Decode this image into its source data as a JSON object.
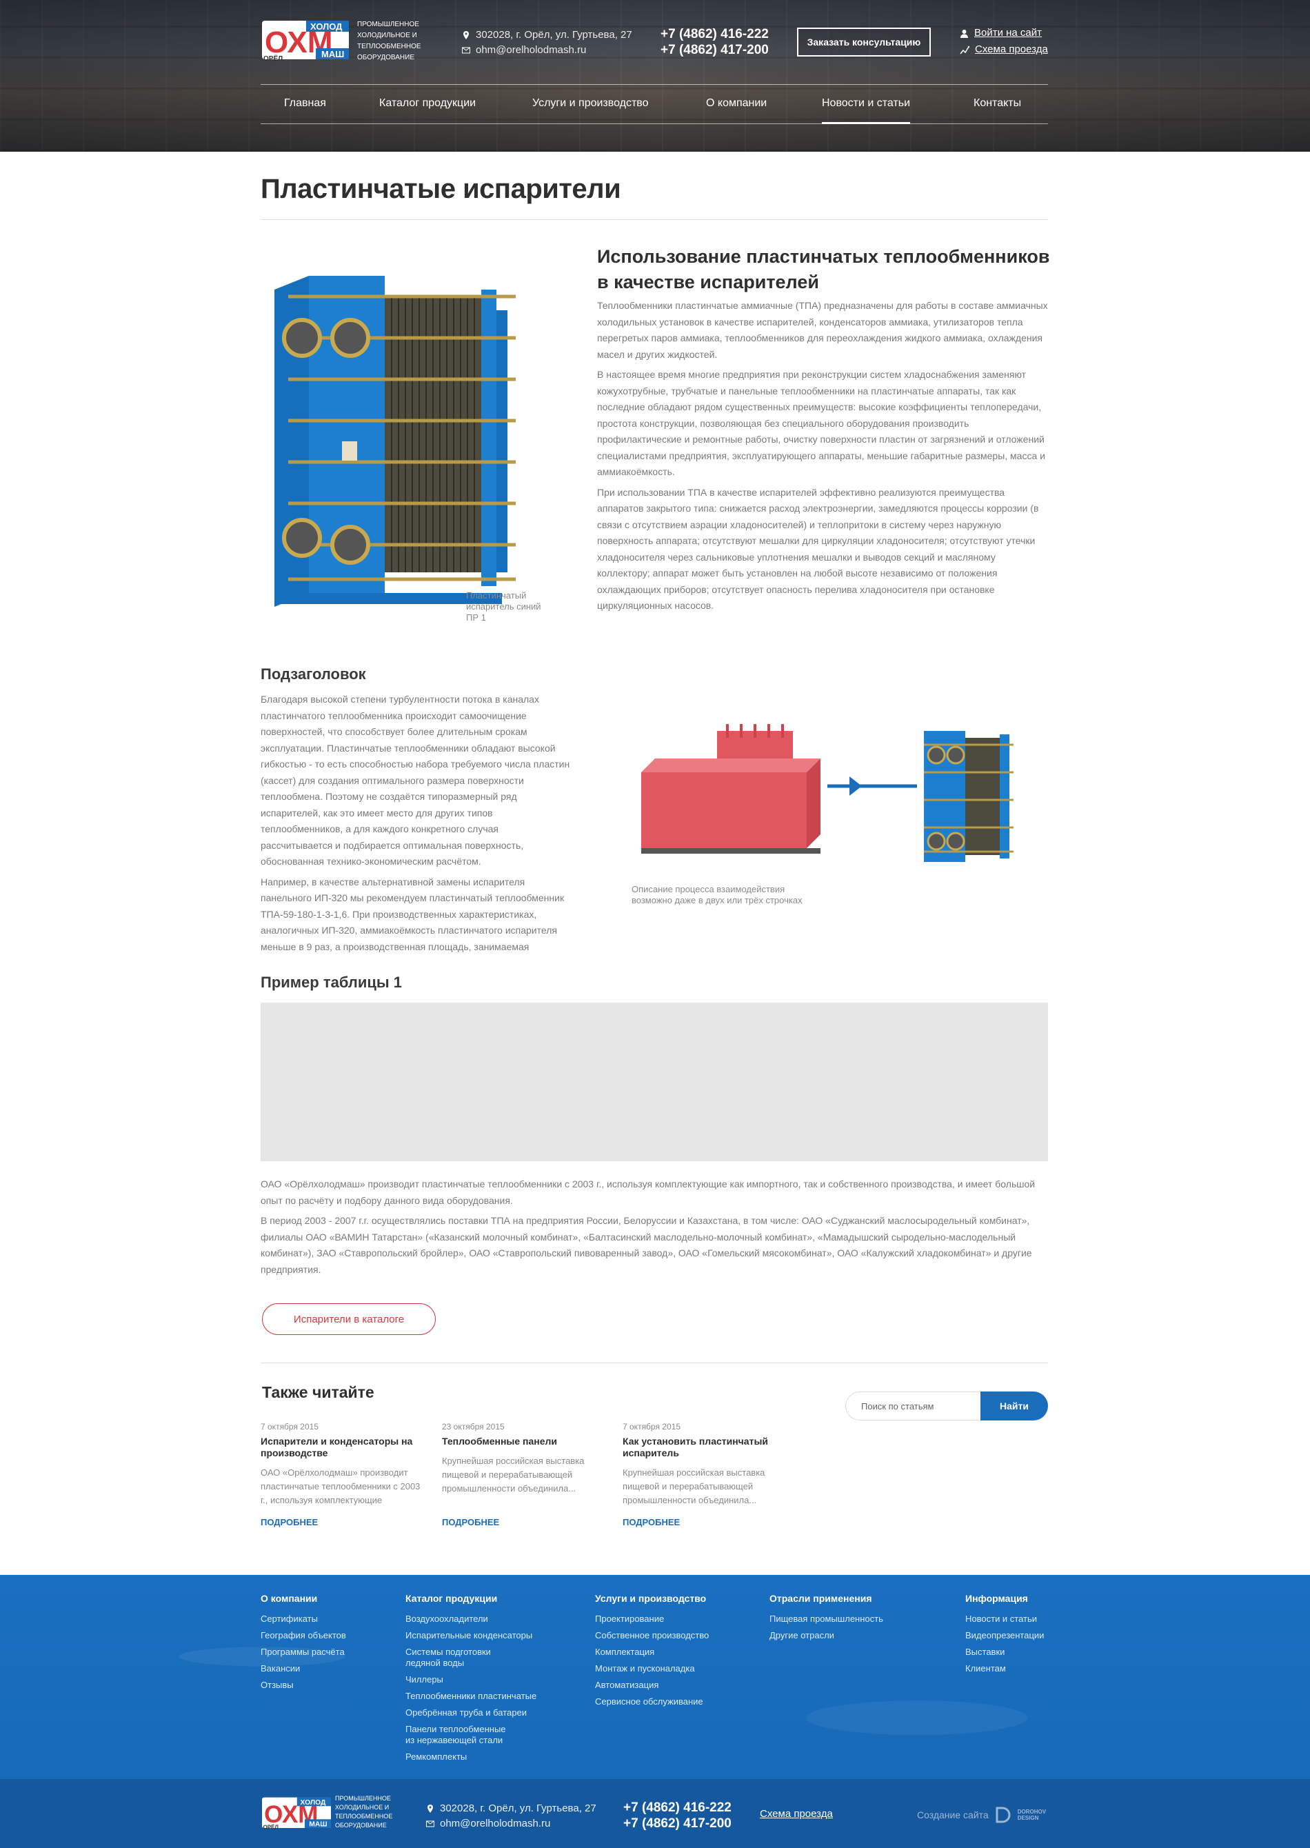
{
  "header": {
    "logo_text": "Промышленное холодильное и теплообменное оборудование",
    "logo_letters": "ОХМ",
    "logo_top": "ХОЛОД",
    "logo_bottom": "МАШ",
    "logo_city": "ОРЁЛ",
    "address": "302028, г. Орёл, ул. Гуртьева, 27",
    "email": "ohm@orelholodmash.ru",
    "phone1": "+7 (4862) 416-222",
    "phone2": "+7 (4862) 417-200",
    "consult_button": "Заказать консультацию",
    "login_link": "Войти на сайт",
    "route_link": "Схема проезда"
  },
  "nav": {
    "items": [
      {
        "label": "Главная"
      },
      {
        "label": "Каталог продукции"
      },
      {
        "label": "Услуги и производство"
      },
      {
        "label": "О компании"
      },
      {
        "label": "Новости и статьи"
      },
      {
        "label": "Контакты"
      }
    ],
    "active": "Новости и статьи"
  },
  "page": {
    "title": "Пластинчатые испарители"
  },
  "section1": {
    "image_caption": "Пластинчатый испаритель синий ПР 1",
    "title": "Использование пластинчатых теплообменников в качестве испарителей",
    "paragraphs": [
      "Теплообменники пластинчатые аммиачные (ТПА) предназначены для работы в составе аммиачных холодильных установок в качестве испарителей, конденсаторов аммиака, утилизаторов тепла перегретых паров аммиака, теплообменников для переохлаждения жидкого аммиака, охлаждения масел и других жидкостей.",
      "В настоящее время многие предприятия при реконструкции систем хладоснабжения заменяют кожухотрубные, трубчатые и панельные теплообменники на пластинчатые аппараты, так как последние обладают рядом существенных преимуществ: высокие коэффициенты теплопередачи, простота конструкции, позволяющая без специального оборудования производить профилактические и ремонтные работы, очистку поверхности пластин от загрязнений и отложений специалистами предприятия, эксплуатирующего аппараты, меньшие габаритные размеры, масса и аммиакоёмкость.",
      "При использовании ТПА в качестве испарителей эффективно реализуются преимущества аппаратов закрытого типа: снижается расход электроэнергии, замедляются процессы коррозии (в связи с отсутствием аэрации хладоносителей) и теплопритоки в систему через наружную поверхность аппарата; отсутствуют мешалки для циркуляции хладоносителя; отсутствуют утечки хладоносителя через сальниковые уплотнения мешалки и выводов секций и масляному коллектору; аппарат может быть установлен на любой высоте независимо от положения охлаждающих приборов; отсутствует опасность перелива хладоносителя при остановке циркуляционных насосов."
    ]
  },
  "section2": {
    "title": "Подзаголовок",
    "paragraphs": [
      "Благодаря высокой степени турбулентности потока в каналах пластинчатого теплообменника происходит самоочищение поверхностей, что способствует более длительным срокам эксплуатации. Пластинчатые теплообменники обладают высокой гибкостью - то есть способностью набора требуемого числа пластин (кассет) для создания оптимального размера поверхности теплообмена. Поэтому не создаётся типоразмерный ряд испарителей, как это имеет место для других типов теплообменников, а для каждого конкретного случая рассчитывается и подбирается оптимальная поверхность, обоснованная технико-экономическим расчётом.",
      "Например, в качестве альтернативной замены испарителя панельного ИП-320 мы рекомендуем пластинчатый теплообменник ТПА-59-180-1-3-1,6. При производственных характеристиках, аналогичных ИП-320, аммиакоёмкость пластинчатого испарителя меньше в 9 раз, а производственная площадь, занимаемая"
    ],
    "image_caption": "Описание процесса взаимодействия возможно даже в двух или трёх строчках"
  },
  "table_section": {
    "title": "Пример таблицы 1"
  },
  "section3": {
    "paragraphs": [
      "ОАО «Орёлхолодмаш» производит пластинчатые теплообменники с 2003 г., используя комплектующие как импортного, так и собственного производства, и имеет большой опыт по расчёту и подбору данного вида оборудования.",
      "В период 2003 - 2007 г.г. осуществлялись поставки ТПА на предприятия России, Белоруссии и Казахстана, в том числе: ОАО «Суджанский маслосыродельный комбинат», филиалы ОАО «ВАМИН Татарстан» («Казанский молочный комбинат», «Балтасинский маслодельно-молочный комбинат», «Мамадышский сыродельно-маслодельный комбинат»), ЗАО «Ставропольский бройлер», ОАО «Ставропольский пивоваренный завод», ОАО «Гомельский мясокомбинат», ОАО «Калужский хладокомбинат» и другие предприятия."
    ],
    "catalog_button": "Испарители в каталоге"
  },
  "also_read": {
    "title": "Также читайте",
    "search_placeholder": "Поиск по статьям",
    "search_button": "Найти",
    "more_label": "ПОДРОБНЕЕ",
    "articles": [
      {
        "date": "7 октября 2015",
        "title": "Испарители и конденсаторы на производстве",
        "excerpt": "ОАО «Орёлхолодмаш» производит пластинчатые теплообменники с 2003 г., используя комплектующие"
      },
      {
        "date": "23 октября 2015",
        "title": "Теплообменные панели",
        "excerpt": "Крупнейшая российская выставка пищевой и перерабатывающей промышленности объединила..."
      },
      {
        "date": "7 октября 2015",
        "title": "Как установить пластинчатый испаритель",
        "excerpt": "Крупнейшая российская выставка пищевой и перерабатывающей промышленности объединила..."
      }
    ]
  },
  "footer": {
    "columns": [
      {
        "heading": "О компании",
        "items": [
          "Сертификаты",
          "География объектов",
          "Программы расчёта",
          "Вакансии",
          "Отзывы"
        ]
      },
      {
        "heading": "Каталог продукции",
        "items": [
          "Воздухоохладители",
          "Испарительные конденсаторы",
          "Системы подготовки ледяной воды",
          "Чиллеры",
          "Теплообменники пластинчатые",
          "Оребрённая труба и батареи",
          "Панели теплообменные из нержавеющей стали",
          "Ремкомплекты"
        ]
      },
      {
        "heading": "Услуги и производство",
        "items": [
          "Проектирование",
          "Собственное производство",
          "Комплектация",
          "Монтаж и пусконаладка",
          "Автоматизация",
          "Сервисное обслуживание"
        ]
      },
      {
        "heading": "Отрасли применения",
        "items": [
          "Пищевая промышленность",
          "Другие отрасли"
        ]
      },
      {
        "heading": "Информация",
        "items": [
          "Новости и статьи",
          "Видеопрезентации",
          "Выставки",
          "Клиентам"
        ]
      }
    ],
    "bottom": {
      "logo_text": "Промышленное холодильное и теплообменное оборудование",
      "address": "302028, г. Орёл, ул. Гуртьева, 27",
      "email": "ohm@orelholodmash.ru",
      "phone1": "+7 (4862) 416-222",
      "phone2": "+7 (4862) 417-200",
      "route_link": "Схема проезда",
      "credit": "Создание сайта",
      "credit_brand_1": "DOROHOV",
      "credit_brand_2": "DESIGN"
    }
  },
  "colors": {
    "brand_blue": "#1a6dbb",
    "accent_red": "#d9373b",
    "equipment_blue": "#1e7fd0",
    "tank_red": "#e0575f"
  }
}
